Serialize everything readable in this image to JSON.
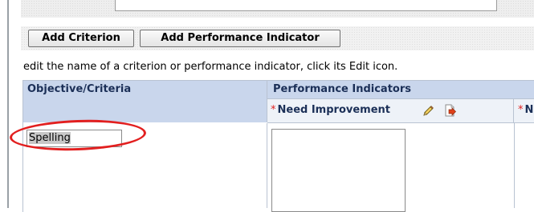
{
  "toolbar": {
    "add_criterion_label": "Add Criterion",
    "add_performance_indicator_label": "Add Performance Indicator"
  },
  "instruction_text": "edit the name of a criterion or performance indicator, click its Edit icon.",
  "table": {
    "objective_header": "Objective/Criteria",
    "performance_header": "Performance Indicators",
    "indicator_columns": [
      {
        "required_mark": "*",
        "label": "Need Improvement",
        "icons": [
          "pencil-edit-icon",
          "move-page-icon"
        ]
      },
      {
        "required_mark": "*",
        "label": "N"
      }
    ],
    "criterion_value": "Spelling"
  },
  "colors": {
    "header_bg": "#c9d6ec",
    "subheader_bg": "#eef2f8",
    "required_star": "#e02020",
    "highlight_oval": "#e21f1f"
  }
}
